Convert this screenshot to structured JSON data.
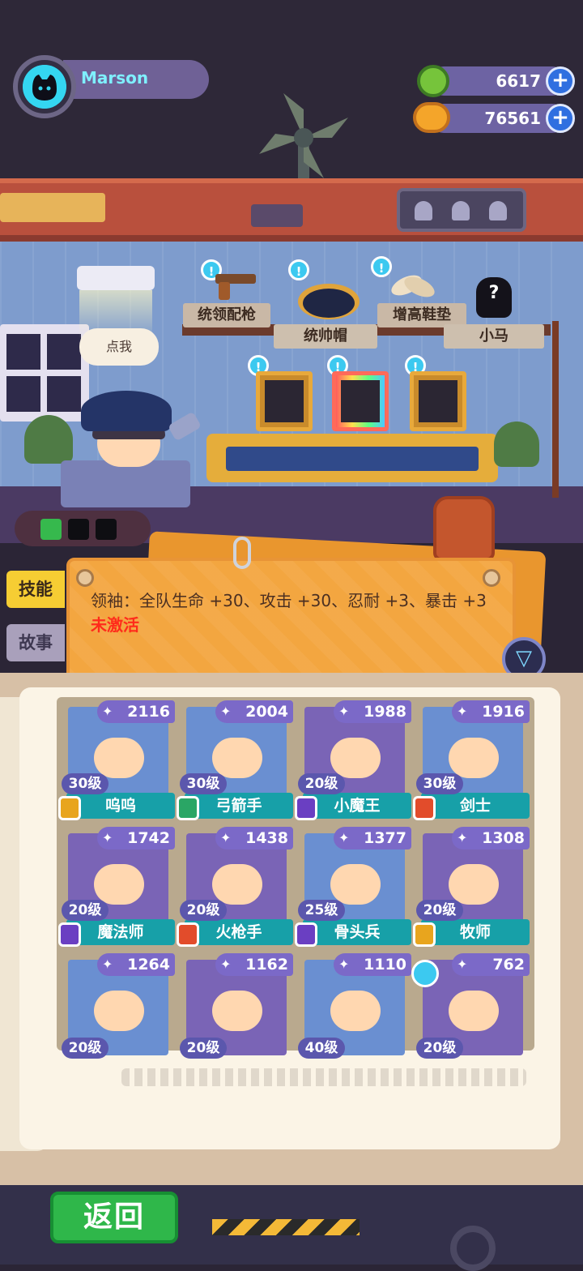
{
  "player": {
    "name": "Marson"
  },
  "currencies": [
    {
      "icon": "gem-icon",
      "value": "6617"
    },
    {
      "icon": "coin-icon",
      "value": "76561"
    }
  ],
  "equipment_labels": [
    "统领配枪",
    "统帅帽",
    "增高鞋垫",
    "小马"
  ],
  "speech_bubble": "点我",
  "tabs": {
    "skill": "技能",
    "story": "故事"
  },
  "skill": {
    "text": "领袖：全队生命 +30、攻击 +30、忍耐 +3、暴击 +3",
    "status": "未激活"
  },
  "heroes": [
    {
      "power": "2116",
      "level": "30级",
      "name": "呜呜",
      "badge_color": "#e8a51e",
      "portrait_color": "#6a8fd1"
    },
    {
      "power": "2004",
      "level": "30级",
      "name": "弓箭手",
      "badge_color": "#2aa665",
      "portrait_color": "#6a8fd1"
    },
    {
      "power": "1988",
      "level": "20级",
      "name": "小魔王",
      "badge_color": "#6a3fc2",
      "portrait_color": "#7a64b6"
    },
    {
      "power": "1916",
      "level": "30级",
      "name": "剑士",
      "badge_color": "#e24c2b",
      "portrait_color": "#6a8fd1"
    },
    {
      "power": "1742",
      "level": "20级",
      "name": "魔法师",
      "badge_color": "#6a3fc2",
      "portrait_color": "#7a64b6"
    },
    {
      "power": "1438",
      "level": "20级",
      "name": "火枪手",
      "badge_color": "#e24c2b",
      "portrait_color": "#7a64b6"
    },
    {
      "power": "1377",
      "level": "25级",
      "name": "骨头兵",
      "badge_color": "#6a3fc2",
      "portrait_color": "#6a8fd1"
    },
    {
      "power": "1308",
      "level": "20级",
      "name": "牧师",
      "badge_color": "#e8a51e",
      "portrait_color": "#7a64b6"
    },
    {
      "power": "1264",
      "level": "20级",
      "name": "",
      "badge_color": "",
      "portrait_color": "#6a8fd1"
    },
    {
      "power": "1162",
      "level": "20级",
      "name": "",
      "badge_color": "",
      "portrait_color": "#7a64b6"
    },
    {
      "power": "1110",
      "level": "40级",
      "name": "",
      "badge_color": "",
      "portrait_color": "#6a8fd1"
    },
    {
      "power": "762",
      "level": "20级",
      "name": "",
      "badge_color": "",
      "portrait_color": "#7a64b6"
    }
  ],
  "back_button": "返回",
  "colors": {
    "accent_red": "#ff2b1b",
    "power_purple": "#7b69c8",
    "name_teal": "#17a0a8"
  }
}
